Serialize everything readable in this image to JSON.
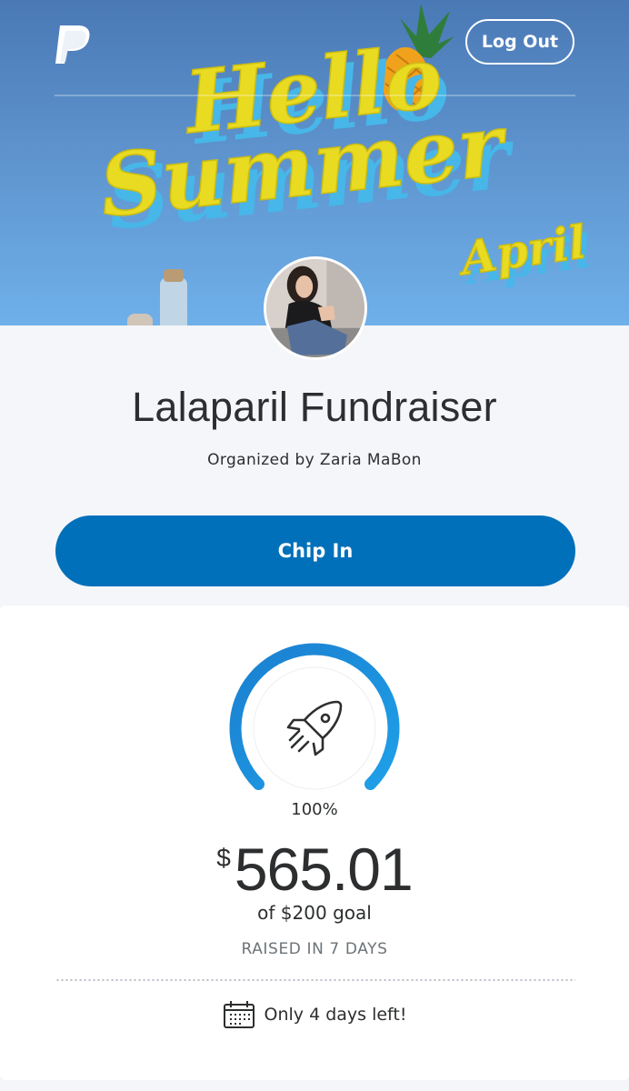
{
  "header": {
    "logout_label": "Log Out",
    "banner_text": {
      "line1": "Hello",
      "line2": "Summer",
      "line3": "April"
    }
  },
  "campaign": {
    "title": "Lalaparil Fundraiser",
    "organizer": "Organized by Zaria MaBon",
    "chip_in_label": "Chip In"
  },
  "progress": {
    "percent_label": "100%",
    "fraction": 1.0,
    "currency_symbol": "$",
    "amount": "565.01",
    "goal_text": "of $200 goal",
    "raised_text": "RAISED IN 7 DAYS",
    "days_left_text": "Only 4 days left!"
  },
  "colors": {
    "primary_blue": "#0070ba",
    "ring_blue": "#1a8ad8",
    "text_dark": "#2c2e2f",
    "text_muted": "#6c7378",
    "banner_yellow": "#e9da22"
  },
  "icons": {
    "logo": "paypal-logo",
    "progress": "rocket-icon",
    "deadline": "calendar-icon"
  }
}
